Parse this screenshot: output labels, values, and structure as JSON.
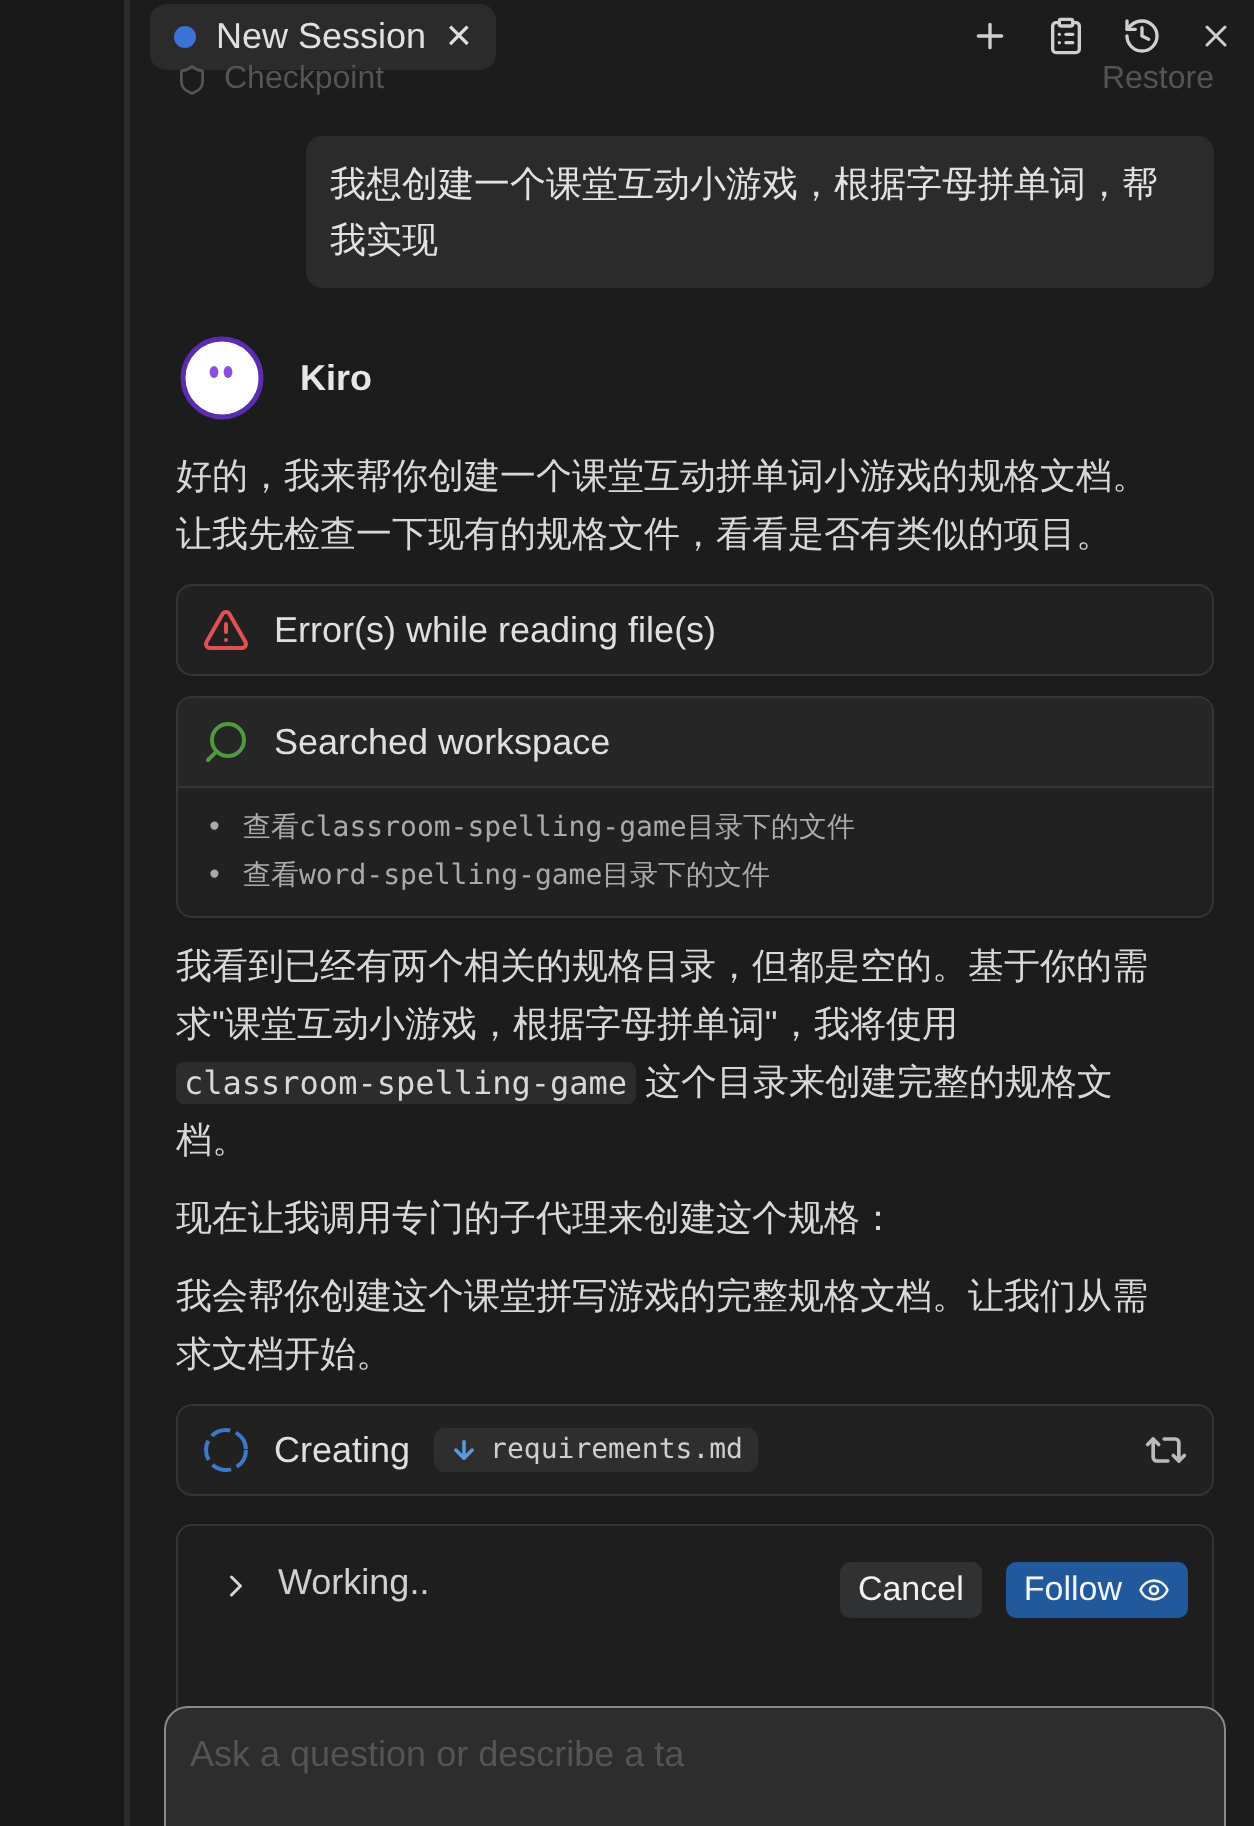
{
  "tab": {
    "label": "New Session",
    "close": "×"
  },
  "checkpoint": {
    "label": "Checkpoint",
    "action": "Restore"
  },
  "user_message": "我想创建一个课堂互动小游戏，根据字母拼单词，帮我实现",
  "assistant": {
    "name": "Kiro"
  },
  "blocks": [
    {
      "kind": "text",
      "segments": [
        {
          "text": "好的，我来帮你创建一个课堂互动拼单词小游戏的规格文档。让我先检查一下现有的规格文件，看看是否有类似的项目。",
          "code": false
        }
      ]
    },
    {
      "kind": "error",
      "title": "Error(s) while reading file(s)"
    },
    {
      "kind": "search",
      "title": "Searched workspace",
      "items": [
        {
          "bullet": "•",
          "text": "查看classroom-spelling-game目录下的文件"
        },
        {
          "bullet": "•",
          "text": "查看word-spelling-game目录下的文件"
        }
      ]
    },
    {
      "kind": "text",
      "segments": [
        {
          "text": "我看到已经有两个相关的规格目录，但都是空的。基于你的需求\"课堂互动小游戏，根据字母拼单词\"，我将使用 ",
          "code": false
        },
        {
          "text": "classroom-spelling-game",
          "code": true
        },
        {
          "text": " 这个目录来创建完整的规格文档。",
          "code": false
        }
      ]
    },
    {
      "kind": "text",
      "segments": [
        {
          "text": "现在让我调用专门的子代理来创建这个规格：",
          "code": false
        }
      ]
    },
    {
      "kind": "text",
      "segments": [
        {
          "text": "我会帮你创建这个课堂拼写游戏的完整规格文档。让我们从需求文档开始。",
          "code": false
        }
      ]
    },
    {
      "kind": "creating",
      "label": "Creating",
      "file": "requirements.md"
    }
  ],
  "status": {
    "label": "Working..",
    "cancel": "Cancel",
    "follow": "Follow"
  },
  "input": {
    "placeholder": "Ask a question or describe a ta"
  }
}
